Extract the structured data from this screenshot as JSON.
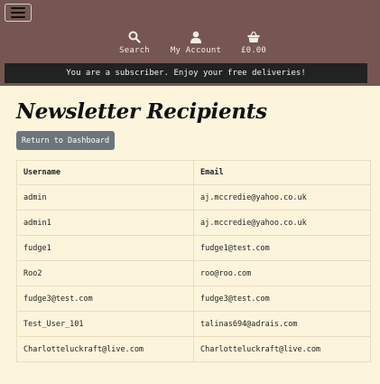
{
  "nav": {
    "search_label": "Search",
    "account_label": "My Account",
    "bag_total": "£0.00"
  },
  "banner": {
    "text": "You are a subscriber. Enjoy your free deliveries!"
  },
  "page": {
    "title": "Newsletter Recipients",
    "back_button": "Return to Dashboard"
  },
  "table": {
    "headers": [
      "Username",
      "Email"
    ],
    "rows": [
      [
        "admin",
        "aj.mccredie@yahoo.co.uk"
      ],
      [
        "admin1",
        "aj.mccredie@yahoo.co.uk"
      ],
      [
        "fudge1",
        "fudge1@test.com"
      ],
      [
        "Roo2",
        "roo@roo.com"
      ],
      [
        "fudge3@test.com",
        "fudge3@test.com"
      ],
      [
        "Test_User_101",
        "talinas694@adrais.com"
      ],
      [
        "Charlotteluckraft@live.com",
        "Charlotteluckraft@live.com"
      ]
    ]
  },
  "colors": {
    "header_bg": "#765652",
    "banner_bg": "#222222",
    "page_bg": "#fdf4dc",
    "button_bg": "#6c757d"
  },
  "icons": [
    "menu-icon",
    "search-icon",
    "user-icon",
    "shopping-basket-icon"
  ]
}
